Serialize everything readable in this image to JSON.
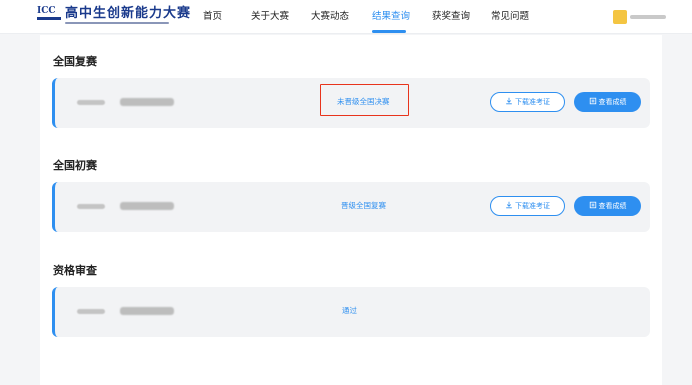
{
  "header": {
    "logo": {
      "mark": "ICC",
      "title": "高中生创新能力大赛"
    },
    "nav": [
      {
        "label": "首页"
      },
      {
        "label": "关于大赛"
      },
      {
        "label": "大赛动态"
      },
      {
        "label": "结果查询",
        "active": true
      },
      {
        "label": "获奖查询"
      },
      {
        "label": "常见问题"
      }
    ]
  },
  "sections": [
    {
      "title": "全国复赛",
      "status": "未晋级全国决赛",
      "download_label": "下载准考证",
      "view_label": "查看成绩"
    },
    {
      "title": "全国初赛",
      "status": "晋级全国复赛",
      "download_label": "下载准考证",
      "view_label": "查看成绩"
    },
    {
      "title": "资格审查",
      "status": "通过"
    }
  ],
  "colors": {
    "accent": "#2e8ff0",
    "highlight": "#e8341c",
    "card_bg": "#f2f3f5"
  },
  "icons": {
    "download": "download-icon",
    "view": "document-icon"
  }
}
